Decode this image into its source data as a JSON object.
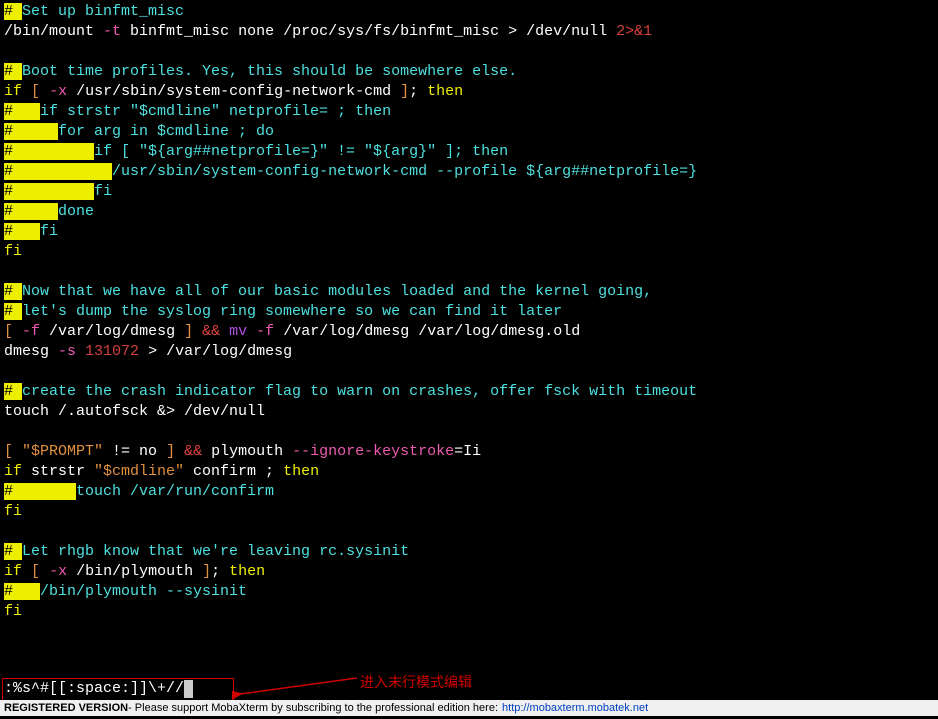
{
  "lines": [
    [
      {
        "t": "# ",
        "cls": "hl"
      },
      {
        "t": "Set up binfmt_misc",
        "cls": "c-teal"
      }
    ],
    [
      {
        "t": "/bin/mount ",
        "cls": "c-white"
      },
      {
        "t": "-t",
        "cls": "c-pink"
      },
      {
        "t": " binfmt_misc none /proc/sys/fs/binfmt_misc > /dev/null ",
        "cls": "c-white"
      },
      {
        "t": "2",
        "cls": "c-num"
      },
      {
        "t": ">&",
        "cls": "c-red"
      },
      {
        "t": "1",
        "cls": "c-num"
      }
    ],
    [
      {
        "t": " ",
        "cls": ""
      }
    ],
    [
      {
        "t": "# ",
        "cls": "hl"
      },
      {
        "t": "Boot time profiles. Yes, this should be somewhere else.",
        "cls": "c-teal"
      }
    ],
    [
      {
        "t": "if",
        "cls": "c-yellow"
      },
      {
        "t": " ",
        "cls": "c-white"
      },
      {
        "t": "[",
        "cls": "c-orange"
      },
      {
        "t": " ",
        "cls": "c-white"
      },
      {
        "t": "-x",
        "cls": "c-pink"
      },
      {
        "t": " /usr/sbin/system-config-network-cmd ",
        "cls": "c-white"
      },
      {
        "t": "]",
        "cls": "c-orange"
      },
      {
        "t": "; ",
        "cls": "c-white"
      },
      {
        "t": "then",
        "cls": "c-yellow"
      }
    ],
    [
      {
        "t": "#   ",
        "cls": "hl"
      },
      {
        "t": "if strstr \"$cmdline\" netprofile= ; then",
        "cls": "c-teal"
      }
    ],
    [
      {
        "t": "#     ",
        "cls": "hl"
      },
      {
        "t": "for arg in $cmdline ; do",
        "cls": "c-teal"
      }
    ],
    [
      {
        "t": "#         ",
        "cls": "hl"
      },
      {
        "t": "if [ \"${arg##netprofile=}\" != \"${arg}\" ]; then",
        "cls": "c-teal"
      }
    ],
    [
      {
        "t": "#           ",
        "cls": "hl"
      },
      {
        "t": "/usr/sbin/system-config-network-cmd --profile ${arg##netprofile=}",
        "cls": "c-teal"
      }
    ],
    [
      {
        "t": "#         ",
        "cls": "hl"
      },
      {
        "t": "fi",
        "cls": "c-teal"
      }
    ],
    [
      {
        "t": "#     ",
        "cls": "hl"
      },
      {
        "t": "done",
        "cls": "c-teal"
      }
    ],
    [
      {
        "t": "#   ",
        "cls": "hl"
      },
      {
        "t": "fi",
        "cls": "c-teal"
      }
    ],
    [
      {
        "t": "fi",
        "cls": "c-yellow"
      }
    ],
    [
      {
        "t": " ",
        "cls": ""
      }
    ],
    [
      {
        "t": "# ",
        "cls": "hl"
      },
      {
        "t": "Now that we have all of our basic modules loaded and the kernel going,",
        "cls": "c-teal"
      }
    ],
    [
      {
        "t": "# ",
        "cls": "hl"
      },
      {
        "t": "let's dump the syslog ring somewhere so we can find it later",
        "cls": "c-teal"
      }
    ],
    [
      {
        "t": "[",
        "cls": "c-orange"
      },
      {
        "t": " ",
        "cls": "c-white"
      },
      {
        "t": "-f",
        "cls": "c-pink"
      },
      {
        "t": " /var/log/dmesg ",
        "cls": "c-white"
      },
      {
        "t": "]",
        "cls": "c-orange"
      },
      {
        "t": " ",
        "cls": "c-white"
      },
      {
        "t": "&&",
        "cls": "c-red"
      },
      {
        "t": " ",
        "cls": "c-white"
      },
      {
        "t": "mv",
        "cls": "c-purple"
      },
      {
        "t": " ",
        "cls": "c-white"
      },
      {
        "t": "-f",
        "cls": "c-pink"
      },
      {
        "t": " /var/log/dmesg /var/log/dmesg.old",
        "cls": "c-white"
      }
    ],
    [
      {
        "t": "dmesg ",
        "cls": "c-white"
      },
      {
        "t": "-s",
        "cls": "c-pink"
      },
      {
        "t": " ",
        "cls": "c-white"
      },
      {
        "t": "131072",
        "cls": "c-num"
      },
      {
        "t": " > /var/log/dmesg",
        "cls": "c-white"
      }
    ],
    [
      {
        "t": " ",
        "cls": ""
      }
    ],
    [
      {
        "t": "# ",
        "cls": "hl"
      },
      {
        "t": "create the crash indicator flag to warn on crashes, offer fsck with timeout",
        "cls": "c-teal"
      }
    ],
    [
      {
        "t": "touch /.autofsck &> /dev/null",
        "cls": "c-white"
      }
    ],
    [
      {
        "t": " ",
        "cls": ""
      }
    ],
    [
      {
        "t": "[",
        "cls": "c-orange"
      },
      {
        "t": " ",
        "cls": "c-white"
      },
      {
        "t": "\"$PROMPT\"",
        "cls": "c-orange"
      },
      {
        "t": " != no ",
        "cls": "c-white"
      },
      {
        "t": "]",
        "cls": "c-orange"
      },
      {
        "t": " ",
        "cls": "c-white"
      },
      {
        "t": "&&",
        "cls": "c-red"
      },
      {
        "t": " plymouth ",
        "cls": "c-white"
      },
      {
        "t": "--ignore-keystroke",
        "cls": "c-pink"
      },
      {
        "t": "=Ii",
        "cls": "c-white"
      }
    ],
    [
      {
        "t": "if",
        "cls": "c-yellow"
      },
      {
        "t": " strstr ",
        "cls": "c-white"
      },
      {
        "t": "\"$cmdline\"",
        "cls": "c-orange"
      },
      {
        "t": " confirm ; ",
        "cls": "c-white"
      },
      {
        "t": "then",
        "cls": "c-yellow"
      }
    ],
    [
      {
        "t": "#       ",
        "cls": "hl"
      },
      {
        "t": "touch /var/run/confirm",
        "cls": "c-teal"
      }
    ],
    [
      {
        "t": "fi",
        "cls": "c-yellow"
      }
    ],
    [
      {
        "t": " ",
        "cls": ""
      }
    ],
    [
      {
        "t": "# ",
        "cls": "hl"
      },
      {
        "t": "Let rhgb know that we're leaving rc.sysinit",
        "cls": "c-teal"
      }
    ],
    [
      {
        "t": "if",
        "cls": "c-yellow"
      },
      {
        "t": " ",
        "cls": "c-white"
      },
      {
        "t": "[",
        "cls": "c-orange"
      },
      {
        "t": " ",
        "cls": "c-white"
      },
      {
        "t": "-x",
        "cls": "c-pink"
      },
      {
        "t": " /bin/plymouth ",
        "cls": "c-white"
      },
      {
        "t": "]",
        "cls": "c-orange"
      },
      {
        "t": "; ",
        "cls": "c-white"
      },
      {
        "t": "then",
        "cls": "c-yellow"
      }
    ],
    [
      {
        "t": "#   ",
        "cls": "hl"
      },
      {
        "t": "/bin/plymouth --sysinit",
        "cls": "c-teal"
      }
    ],
    [
      {
        "t": "fi",
        "cls": "c-yellow"
      }
    ]
  ],
  "cmdline": ":%s^#[[:space:]]\\+//",
  "annotation": "进入末行模式编辑",
  "status": {
    "prefix": "REGISTERED VERSION",
    "middle": " - Please support MobaXterm by subscribing to the professional edition here: ",
    "link": "http://mobaxterm.mobatek.net"
  }
}
